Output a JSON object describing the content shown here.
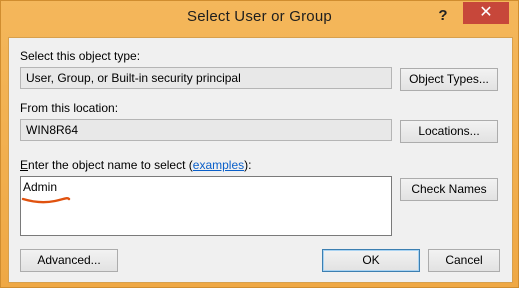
{
  "window": {
    "title": "Select User or Group",
    "help_glyph": "?",
    "close_glyph": "✕"
  },
  "object_type": {
    "label": "Select this object type:",
    "value": "User, Group, or Built-in security principal",
    "button": "Object Types..."
  },
  "location": {
    "label": "From this location:",
    "value": "WIN8R64",
    "button": "Locations..."
  },
  "object_name": {
    "label_hotkey": "E",
    "label_rest": "nter the object name to select (",
    "link": "examples",
    "label_end": "):",
    "value": "Admin",
    "check_button": "Check Names"
  },
  "footer": {
    "advanced_button": "Advanced...",
    "ok_button": "OK",
    "cancel_button": "Cancel"
  },
  "colors": {
    "frame": "#f0ad4e",
    "close_button": "#c7473a",
    "link": "#0a5fc9",
    "annotation": "#e0520f"
  }
}
